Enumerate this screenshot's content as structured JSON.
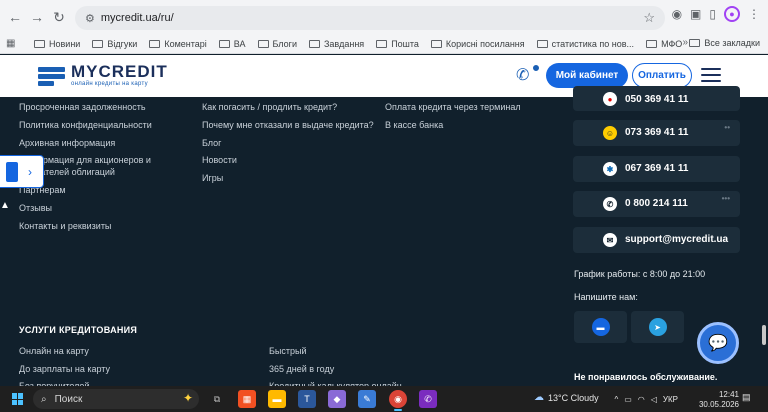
{
  "browser": {
    "url": "mycredit.ua/ru/",
    "bookmarks": [
      "Новини",
      "Відгуки",
      "Коментарі",
      "ВА",
      "Блоги",
      "Завдання",
      "Пошта",
      "Корисні посилання",
      "статистика по нов...",
      "МФО"
    ],
    "all_bookmarks": "Все закладки",
    "more": "»"
  },
  "header": {
    "brand": "MYCREDIT",
    "tagline": "онлайн кредиты на карту",
    "cabinet_label": "Мой кабинет",
    "pay_label": "Оплатить"
  },
  "footer": {
    "col1": [
      "Просроченная задолженность",
      "Политика конфиденциальности",
      "Архивная информация",
      "Информация для акционеров и",
      "держателей облигаций",
      "Партнерам",
      "Отзывы",
      "Контакты и реквизиты"
    ],
    "col2": [
      "Как погасить / продлить кредит?",
      "Почему мне отказали в выдаче кредита?",
      "Блог",
      "Новости",
      "Игры"
    ],
    "col3": [
      "Оплата кредита через терминал",
      "В кассе банка"
    ],
    "credit_services_heading": "УСЛУГИ КРЕДИТОВАНИЯ",
    "services_col1": [
      "Онлайн на карту",
      "До зарплаты на карту",
      "Без поручителей"
    ],
    "services_col2": [
      "Быстрый",
      "365 дней в году",
      "Кредитный калькулятор онлайн"
    ],
    "contacts": [
      {
        "icon": "vodafone-icon",
        "text": "050 369 41 11"
      },
      {
        "icon": "lifecell-icon",
        "text": "073 369 41 11"
      },
      {
        "icon": "kyivstar-icon",
        "text": "067 369 41 11"
      },
      {
        "icon": "phone-icon",
        "text": "0 800 214 111"
      },
      {
        "icon": "mail-icon",
        "text": "support@mycredit.ua"
      }
    ],
    "schedule": "График работы: с 8:00 до 21:00",
    "write_us": "Напишите нам:",
    "complaint": "Не понравилось обслуживание."
  },
  "taskbar": {
    "search_placeholder": "Поиск",
    "weather": "13°C  Cloudy",
    "lang": "УКР",
    "time": "12:41",
    "date": "30.05.2026"
  }
}
